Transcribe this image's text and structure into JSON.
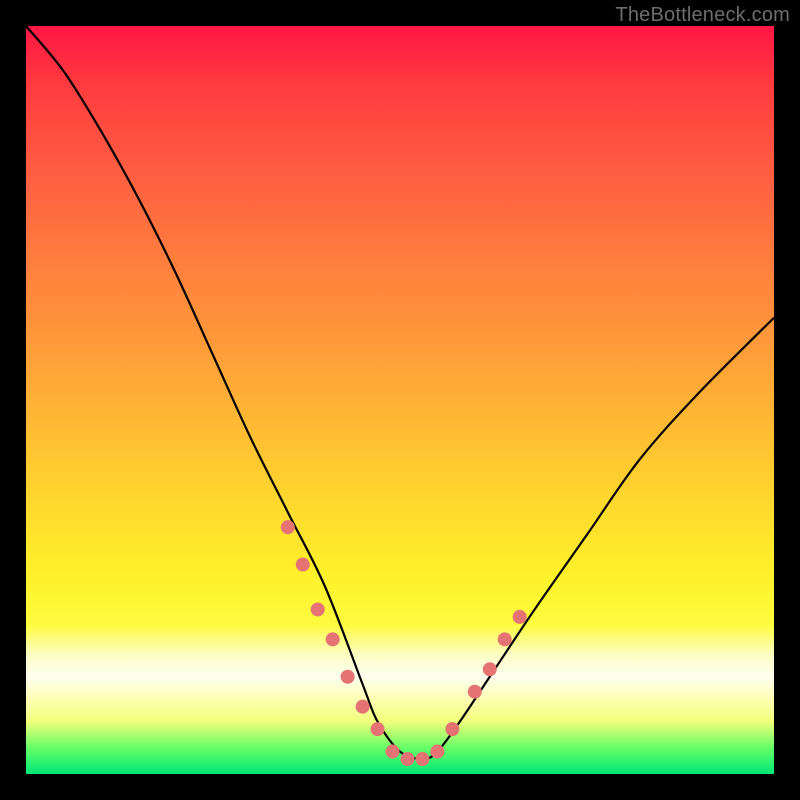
{
  "watermark": "TheBottleneck.com",
  "chart_data": {
    "type": "line",
    "title": "",
    "xlabel": "",
    "ylabel": "",
    "xlim": [
      0,
      100
    ],
    "ylim": [
      0,
      100
    ],
    "series": [
      {
        "name": "curve",
        "x": [
          0,
          5,
          10,
          15,
          20,
          25,
          30,
          35,
          40,
          45,
          47,
          50,
          53,
          55,
          58,
          62,
          68,
          75,
          82,
          90,
          100
        ],
        "values": [
          100,
          94,
          86,
          77,
          67,
          56,
          45,
          35,
          25,
          12,
          7,
          3,
          2,
          3,
          7,
          13,
          22,
          32,
          42,
          51,
          61
        ]
      }
    ],
    "markers": {
      "name": "dots",
      "x": [
        35,
        37,
        39,
        41,
        43,
        45,
        47,
        49,
        51,
        53,
        55,
        57,
        60,
        62,
        64,
        66
      ],
      "values": [
        33,
        28,
        22,
        18,
        13,
        9,
        6,
        3,
        2,
        2,
        3,
        6,
        11,
        14,
        18,
        21
      ]
    },
    "styles": {
      "curve_color": "#000000",
      "curve_width": 2.2,
      "marker_color": "#e57373",
      "marker_radius": 7
    }
  }
}
